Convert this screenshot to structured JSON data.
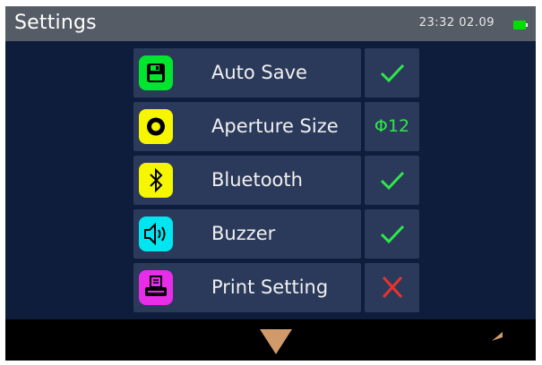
{
  "header": {
    "title": "Settings",
    "datetime": "23:32 02.09",
    "battery_icon": "battery-icon",
    "battery_color": "#00e000"
  },
  "settings": [
    {
      "label": "Auto Save",
      "icon": "save-icon",
      "icon_color": "#00e62e",
      "value_icon": "check-icon"
    },
    {
      "label": "Aperture Size",
      "icon": "aperture-icon",
      "icon_color": "#f6f600",
      "value_text": "Φ12"
    },
    {
      "label": "Bluetooth",
      "icon": "bluetooth-icon",
      "icon_color": "#f6f600",
      "value_icon": "check-icon"
    },
    {
      "label": "Buzzer",
      "icon": "speaker-icon",
      "icon_color": "#00e6f0",
      "value_icon": "check-icon"
    },
    {
      "label": "Print Setting",
      "icon": "printer-icon",
      "icon_color": "#e82de8",
      "value_icon": "cross-icon"
    }
  ],
  "footer": {
    "down_icon": "chevron-down-icon",
    "back_icon": "back-arrow-icon"
  },
  "colors": {
    "background": "#0f1d3d",
    "row": "#2b3a5a",
    "header": "#565c66",
    "check": "#2ee84a",
    "cross": "#e8332d",
    "nav_arrow": "#d19a6b"
  }
}
